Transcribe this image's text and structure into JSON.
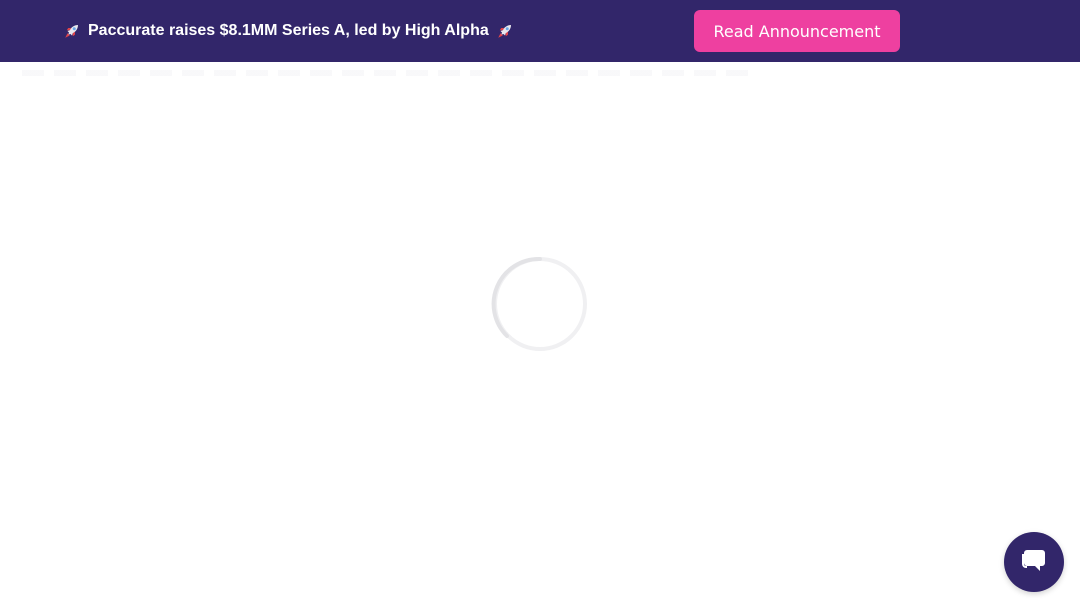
{
  "banner": {
    "message": "Paccurate raises $8.1MM Series A, led by High Alpha",
    "button_label": "Read Announcement",
    "background_color": "#32266a",
    "button_color": "#ee40a0"
  },
  "icons": {
    "banner_left": "rocket-icon",
    "banner_right": "rocket-icon",
    "loader": "loading-spinner",
    "chat": "chat-bubble-icon"
  }
}
